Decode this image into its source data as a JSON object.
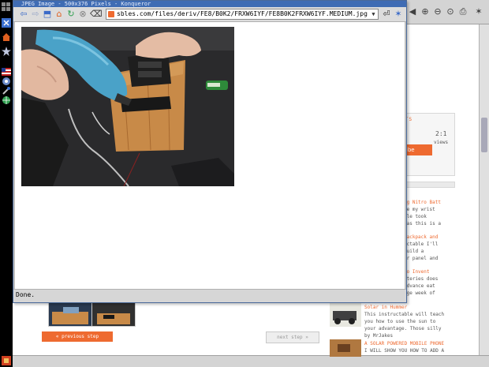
{
  "foreground_window": {
    "title": "JPEG Image - 500x376 Pixels - Konqueror",
    "location_url": "sbles.com/files/deriv/FE8/B0K2/FRXW6IYF/FE8B0K2FRXW6IYF.MEDIUM.jpg",
    "status_text": "Done."
  },
  "background_page": {
    "stats_header": "STATS",
    "views_count": "2:1",
    "views_label": "views",
    "subscribe_label": "ribe",
    "related": [
      {
        "title": "ng Nitro Batt",
        "lines": [
          "se my wrist",
          "ble took",
          "was this is a"
        ]
      },
      {
        "title": "Backpack and",
        "lines": [
          "uctable I'll",
          "build a",
          "ar panel and"
        ]
      },
      {
        "title": "to Invent",
        "lines": [
          "tteries does",
          "Advance eat",
          "age week of"
        ]
      },
      {
        "title": "Solar in Hummer",
        "lines": [
          "This instructable will teach",
          "you how to use the sun to",
          "your advantage. Those silly",
          "by MrJakes"
        ]
      },
      {
        "title": "A SOLAR POWERED MOBILE PHONE",
        "lines": [
          "I WILL SHOW YOU HOW TO ADD A"
        ]
      }
    ],
    "prev_step_label": "« previous step",
    "next_step_label": "next step »"
  },
  "colors": {
    "accent_orange": "#ee6a30",
    "titlebar_blue": "#3f6cb4",
    "wood": "#c88a48"
  }
}
